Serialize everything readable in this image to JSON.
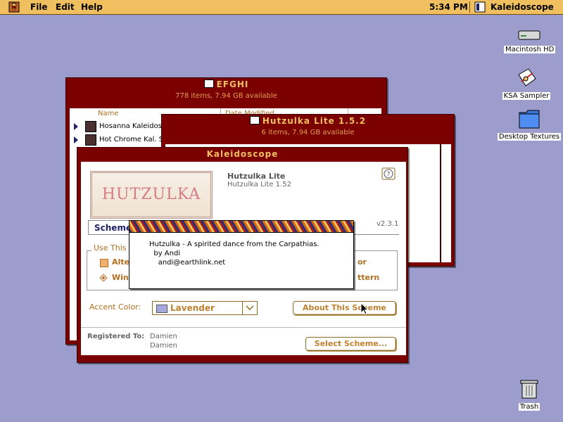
{
  "menubar": {
    "menus": [
      "File",
      "Edit",
      "Help"
    ],
    "clock": "5:34 PM",
    "app_name": "Kaleidoscope"
  },
  "desktop": {
    "icons": [
      {
        "name": "Macintosh HD",
        "icon": "hard-disk-icon"
      },
      {
        "name": "KSA Sampler",
        "icon": "document-icon"
      },
      {
        "name": "Desktop Textures",
        "icon": "folder-icon"
      },
      {
        "name": "Trash",
        "icon": "trash-icon"
      }
    ]
  },
  "window_efghi": {
    "title": "EFGHI",
    "info": "778 items, 7.94 GB available",
    "columns": [
      "Name",
      "Date Modified"
    ],
    "rows": [
      "Hosanna Kaleidosco",
      "Hot Chrome Kal. S"
    ]
  },
  "window_hutzulka": {
    "title": "Hutzulka Lite 1.5.2",
    "info": "6 items, 7.94 GB available"
  },
  "kaleidoscope": {
    "title": "Kaleidoscope",
    "logo_text": "HUTZULKA",
    "scheme_name": "Hutzulka Lite",
    "scheme_version": "Hutzulka Lite 1.52",
    "version": "v2.3.1",
    "tab_label": "Scheme",
    "use_this_label": "Use This",
    "option1_label": "Alte",
    "option1_suffix": "or",
    "option2_label": "Win",
    "option2_suffix": "ttern",
    "accent_label": "Accent Color:",
    "accent_value": "Lavender",
    "about_button": "About This Scheme",
    "registered_label": "Registered To:",
    "registered_name": "Damien",
    "registered_org": "Damien",
    "select_button": "Select Scheme..."
  },
  "note": {
    "text": "Hutzulka - A spirited dance from the Carpathias.\n  by Andi\n    andi@earthlink.net"
  },
  "colors": {
    "menubar": "#f0c060",
    "desktop": "#9c9ccd",
    "window_frame": "#7b0000",
    "accent_text": "#c08030"
  }
}
